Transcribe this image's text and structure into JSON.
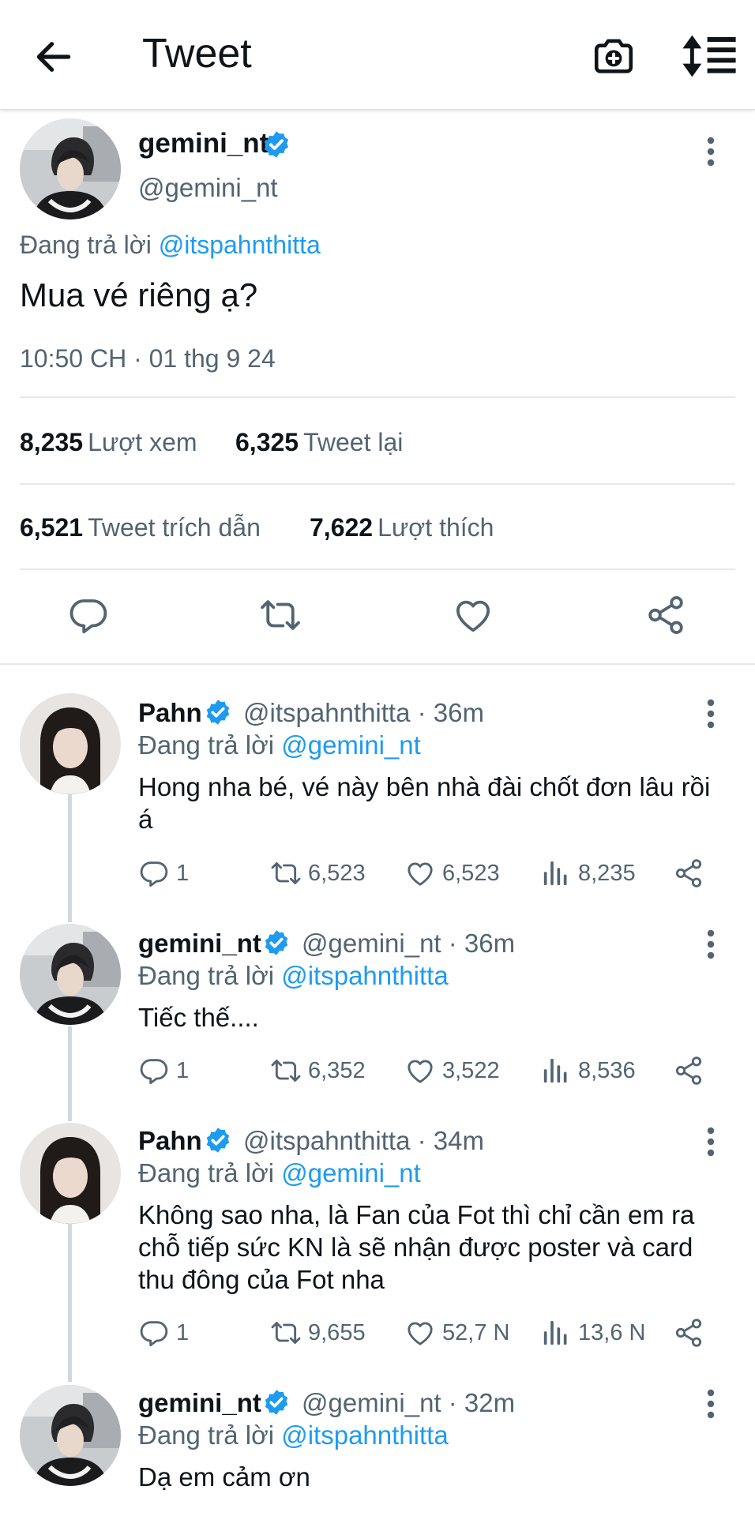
{
  "header": {
    "title": "Tweet"
  },
  "main_tweet": {
    "author_name": "gemini_nt",
    "handle": "@gemini_nt",
    "reply_prefix": "Đang trả lời",
    "reply_to": "@itspahnthitta",
    "text": "Mua vé riêng ạ?",
    "timestamp": "10:50 CH · 01 thg 9 24",
    "stats": {
      "views_count": "8,235",
      "views_label": "Lượt xem",
      "retweets_count": "6,325",
      "retweets_label": "Tweet lại",
      "quotes_count": "6,521",
      "quotes_label": "Tweet trích dẫn",
      "likes_count": "7,622",
      "likes_label": "Lượt thích"
    }
  },
  "replies": [
    {
      "name": "Pahn",
      "handle": "@itspahnthitta",
      "time": "· 36m",
      "reply_prefix": "Đang trả lời",
      "reply_to": "@gemini_nt",
      "text": "Hong nha bé, vé này bên nhà đài chốt đơn lâu rồi á",
      "replies": "1",
      "retweets": "6,523",
      "likes": "6,523",
      "views": "8,235"
    },
    {
      "name": "gemini_nt",
      "handle": "@gemini_nt",
      "time": "· 36m",
      "reply_prefix": "Đang trả lời",
      "reply_to": "@itspahnthitta",
      "text": "Tiếc thế....",
      "replies": "1",
      "retweets": "6,352",
      "likes": "3,522",
      "views": "8,536"
    },
    {
      "name": "Pahn",
      "handle": "@itspahnthitta",
      "time": "· 34m",
      "reply_prefix": "Đang trả lời",
      "reply_to": "@gemini_nt",
      "text": "Không sao nha, là Fan của Fot thì chỉ cần em ra chỗ tiếp sức KN là sẽ nhận được poster và card thu đông của Fot nha",
      "replies": "1",
      "retweets": "9,655",
      "likes": "52,7 N",
      "views": "13,6 N"
    },
    {
      "name": "gemini_nt",
      "handle": "@gemini_nt",
      "time": "· 32m",
      "reply_prefix": "Đang trả lời",
      "reply_to": "@itspahnthitta",
      "text": "Dạ em cảm ơn"
    }
  ],
  "colors": {
    "accent": "#1d9bf0",
    "text": "#0f1419",
    "secondary": "#536471",
    "divider": "#e6e9eb"
  },
  "icons": [
    "back-arrow-icon",
    "camera-plus-icon",
    "sort-icon",
    "more-icon",
    "reply-icon",
    "retweet-icon",
    "like-icon",
    "views-icon",
    "share-icon",
    "verified-icon"
  ]
}
